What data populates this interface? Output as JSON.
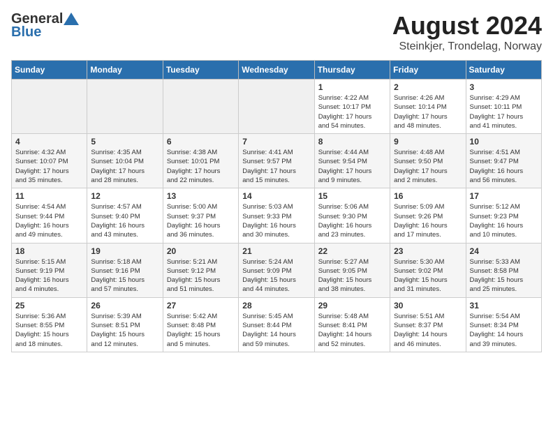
{
  "logo": {
    "general": "General",
    "blue": "Blue"
  },
  "title": "August 2024",
  "location": "Steinkjer, Trondelag, Norway",
  "days_of_week": [
    "Sunday",
    "Monday",
    "Tuesday",
    "Wednesday",
    "Thursday",
    "Friday",
    "Saturday"
  ],
  "weeks": [
    [
      {
        "day": "",
        "detail": ""
      },
      {
        "day": "",
        "detail": ""
      },
      {
        "day": "",
        "detail": ""
      },
      {
        "day": "",
        "detail": ""
      },
      {
        "day": "1",
        "detail": "Sunrise: 4:22 AM\nSunset: 10:17 PM\nDaylight: 17 hours\nand 54 minutes."
      },
      {
        "day": "2",
        "detail": "Sunrise: 4:26 AM\nSunset: 10:14 PM\nDaylight: 17 hours\nand 48 minutes."
      },
      {
        "day": "3",
        "detail": "Sunrise: 4:29 AM\nSunset: 10:11 PM\nDaylight: 17 hours\nand 41 minutes."
      }
    ],
    [
      {
        "day": "4",
        "detail": "Sunrise: 4:32 AM\nSunset: 10:07 PM\nDaylight: 17 hours\nand 35 minutes."
      },
      {
        "day": "5",
        "detail": "Sunrise: 4:35 AM\nSunset: 10:04 PM\nDaylight: 17 hours\nand 28 minutes."
      },
      {
        "day": "6",
        "detail": "Sunrise: 4:38 AM\nSunset: 10:01 PM\nDaylight: 17 hours\nand 22 minutes."
      },
      {
        "day": "7",
        "detail": "Sunrise: 4:41 AM\nSunset: 9:57 PM\nDaylight: 17 hours\nand 15 minutes."
      },
      {
        "day": "8",
        "detail": "Sunrise: 4:44 AM\nSunset: 9:54 PM\nDaylight: 17 hours\nand 9 minutes."
      },
      {
        "day": "9",
        "detail": "Sunrise: 4:48 AM\nSunset: 9:50 PM\nDaylight: 17 hours\nand 2 minutes."
      },
      {
        "day": "10",
        "detail": "Sunrise: 4:51 AM\nSunset: 9:47 PM\nDaylight: 16 hours\nand 56 minutes."
      }
    ],
    [
      {
        "day": "11",
        "detail": "Sunrise: 4:54 AM\nSunset: 9:44 PM\nDaylight: 16 hours\nand 49 minutes."
      },
      {
        "day": "12",
        "detail": "Sunrise: 4:57 AM\nSunset: 9:40 PM\nDaylight: 16 hours\nand 43 minutes."
      },
      {
        "day": "13",
        "detail": "Sunrise: 5:00 AM\nSunset: 9:37 PM\nDaylight: 16 hours\nand 36 minutes."
      },
      {
        "day": "14",
        "detail": "Sunrise: 5:03 AM\nSunset: 9:33 PM\nDaylight: 16 hours\nand 30 minutes."
      },
      {
        "day": "15",
        "detail": "Sunrise: 5:06 AM\nSunset: 9:30 PM\nDaylight: 16 hours\nand 23 minutes."
      },
      {
        "day": "16",
        "detail": "Sunrise: 5:09 AM\nSunset: 9:26 PM\nDaylight: 16 hours\nand 17 minutes."
      },
      {
        "day": "17",
        "detail": "Sunrise: 5:12 AM\nSunset: 9:23 PM\nDaylight: 16 hours\nand 10 minutes."
      }
    ],
    [
      {
        "day": "18",
        "detail": "Sunrise: 5:15 AM\nSunset: 9:19 PM\nDaylight: 16 hours\nand 4 minutes."
      },
      {
        "day": "19",
        "detail": "Sunrise: 5:18 AM\nSunset: 9:16 PM\nDaylight: 15 hours\nand 57 minutes."
      },
      {
        "day": "20",
        "detail": "Sunrise: 5:21 AM\nSunset: 9:12 PM\nDaylight: 15 hours\nand 51 minutes."
      },
      {
        "day": "21",
        "detail": "Sunrise: 5:24 AM\nSunset: 9:09 PM\nDaylight: 15 hours\nand 44 minutes."
      },
      {
        "day": "22",
        "detail": "Sunrise: 5:27 AM\nSunset: 9:05 PM\nDaylight: 15 hours\nand 38 minutes."
      },
      {
        "day": "23",
        "detail": "Sunrise: 5:30 AM\nSunset: 9:02 PM\nDaylight: 15 hours\nand 31 minutes."
      },
      {
        "day": "24",
        "detail": "Sunrise: 5:33 AM\nSunset: 8:58 PM\nDaylight: 15 hours\nand 25 minutes."
      }
    ],
    [
      {
        "day": "25",
        "detail": "Sunrise: 5:36 AM\nSunset: 8:55 PM\nDaylight: 15 hours\nand 18 minutes."
      },
      {
        "day": "26",
        "detail": "Sunrise: 5:39 AM\nSunset: 8:51 PM\nDaylight: 15 hours\nand 12 minutes."
      },
      {
        "day": "27",
        "detail": "Sunrise: 5:42 AM\nSunset: 8:48 PM\nDaylight: 15 hours\nand 5 minutes."
      },
      {
        "day": "28",
        "detail": "Sunrise: 5:45 AM\nSunset: 8:44 PM\nDaylight: 14 hours\nand 59 minutes."
      },
      {
        "day": "29",
        "detail": "Sunrise: 5:48 AM\nSunset: 8:41 PM\nDaylight: 14 hours\nand 52 minutes."
      },
      {
        "day": "30",
        "detail": "Sunrise: 5:51 AM\nSunset: 8:37 PM\nDaylight: 14 hours\nand 46 minutes."
      },
      {
        "day": "31",
        "detail": "Sunrise: 5:54 AM\nSunset: 8:34 PM\nDaylight: 14 hours\nand 39 minutes."
      }
    ]
  ]
}
